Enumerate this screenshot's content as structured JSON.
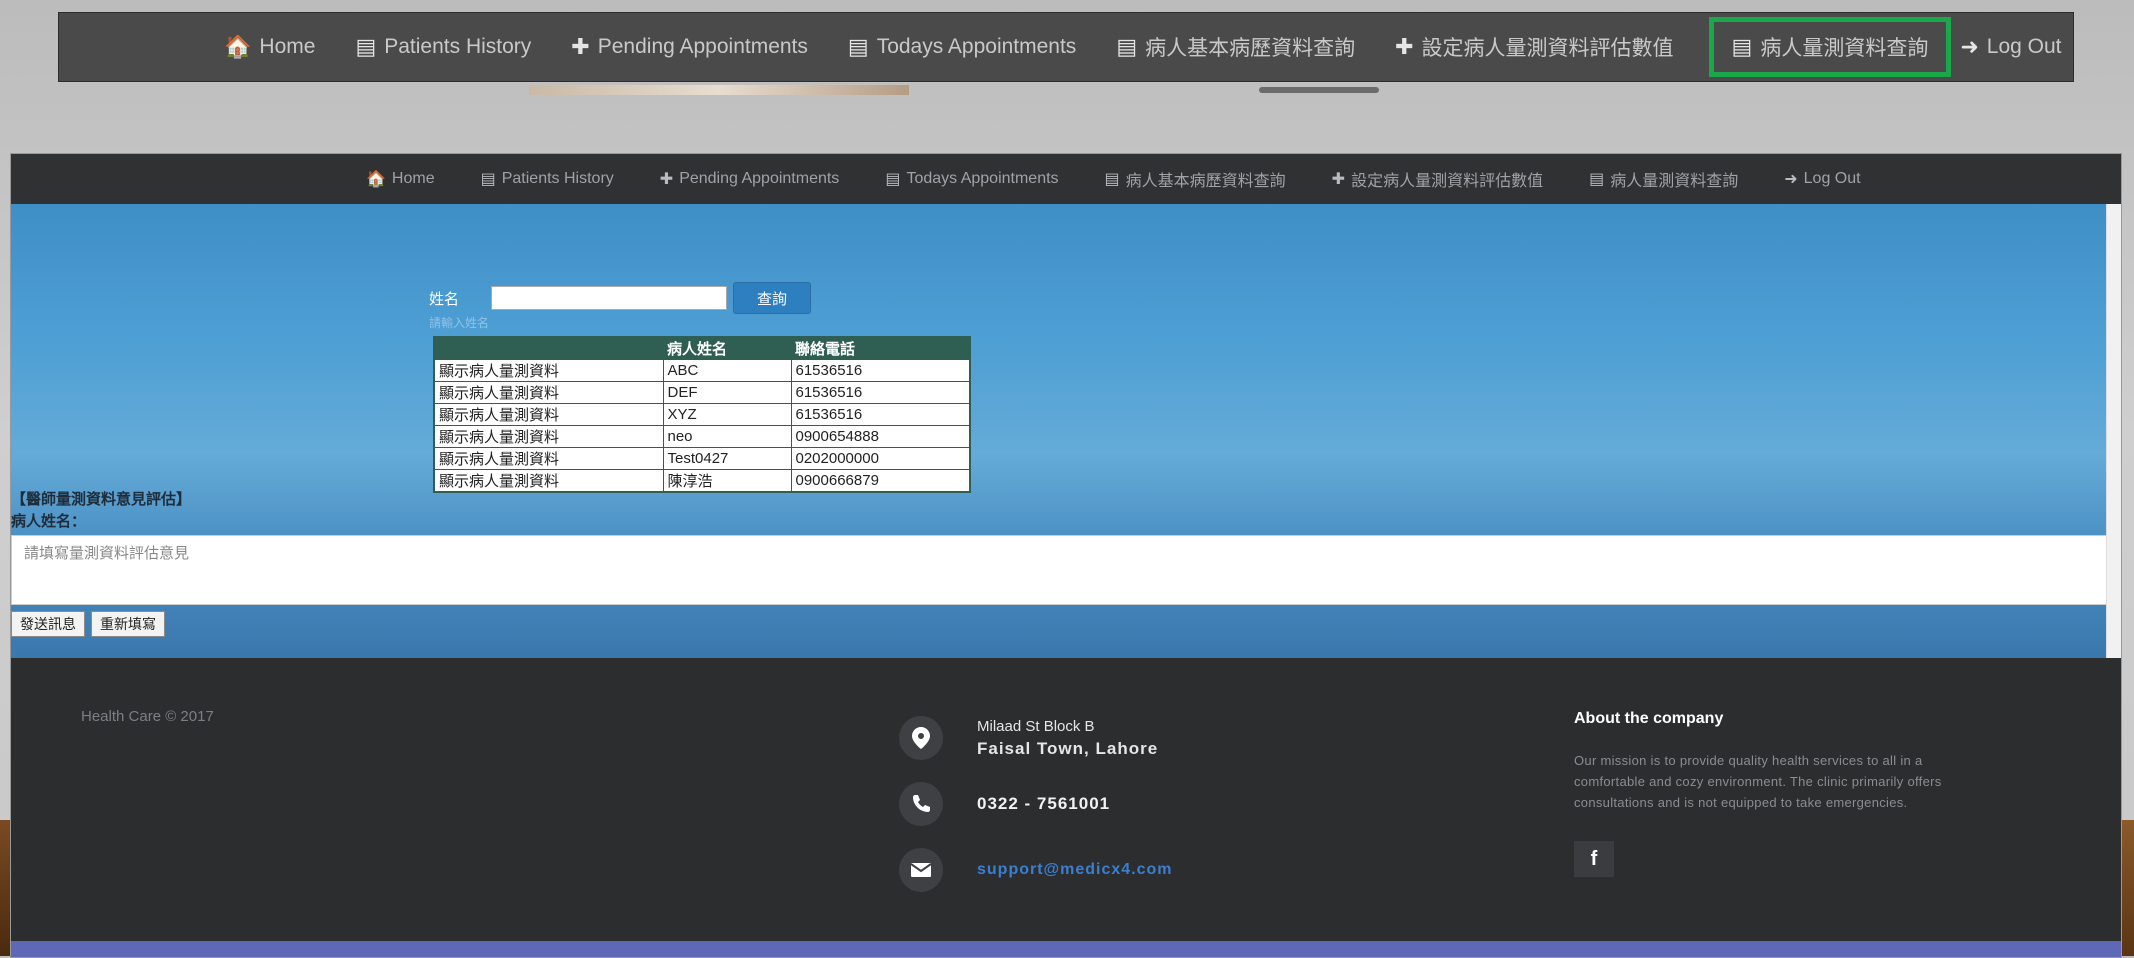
{
  "nav": {
    "items": [
      {
        "icon": "home-icon",
        "glyph": "🏠",
        "label": "Home"
      },
      {
        "icon": "list-icon",
        "glyph": "▤",
        "label": "Patients History"
      },
      {
        "icon": "plus-icon",
        "glyph": "✚",
        "label": "Pending Appointments"
      },
      {
        "icon": "list-icon",
        "glyph": "▤",
        "label": "Todays Appointments"
      },
      {
        "icon": "list-icon",
        "glyph": "▤",
        "label": "病人基本病歷資料查詢"
      },
      {
        "icon": "plus-icon",
        "glyph": "✚",
        "label": "設定病人量測資料評估數值"
      },
      {
        "icon": "list-icon",
        "glyph": "▤",
        "label": "病人量測資料查詢"
      },
      {
        "icon": "logout-icon",
        "glyph": "➜",
        "label": "Log Out"
      }
    ],
    "highlight_color": "#1aa84a"
  },
  "search": {
    "label": "姓名",
    "value": "",
    "button": "查詢",
    "hint": "請輸入姓名"
  },
  "table": {
    "headers": [
      "",
      "病人姓名",
      "聯絡電話"
    ],
    "rows": [
      [
        "顯示病人量測資料",
        "ABC",
        "61536516"
      ],
      [
        "顯示病人量測資料",
        "DEF",
        "61536516"
      ],
      [
        "顯示病人量測資料",
        "XYZ",
        "61536516"
      ],
      [
        "顯示病人量測資料",
        "neo",
        "0900654888"
      ],
      [
        "顯示病人量測資料",
        "Test0427",
        "0202000000"
      ],
      [
        "顯示病人量測資料",
        "陳淳浩",
        "0900666879"
      ]
    ]
  },
  "evaluation": {
    "title": "【醫師量測資料意見評估】",
    "patient_label": "病人姓名：",
    "placeholder": "請填寫量測資料評估意見",
    "send_button": "發送訊息",
    "reset_button": "重新填寫"
  },
  "footer": {
    "copyright": "Health Care © 2017",
    "address_line1": "Milaad St Block B",
    "address_line2": "Faisal Town, Lahore",
    "phone": "0322 - 7561001",
    "email": "support@medicx4.com",
    "about_title": "About the company",
    "about_text": "Our mission is to provide quality health services to all in a comfortable and cozy environment. The clinic primarily offers consultations and is not equipped to take emergencies.",
    "facebook": "f"
  },
  "colors": {
    "nav_bg": "#2f3133",
    "hero_blue": "#4e9fd4",
    "table_header": "#2f5e52",
    "footer_bg": "#2c2d2f",
    "email_link": "#3b7fd1",
    "bottom_bar": "#5e68b6"
  }
}
